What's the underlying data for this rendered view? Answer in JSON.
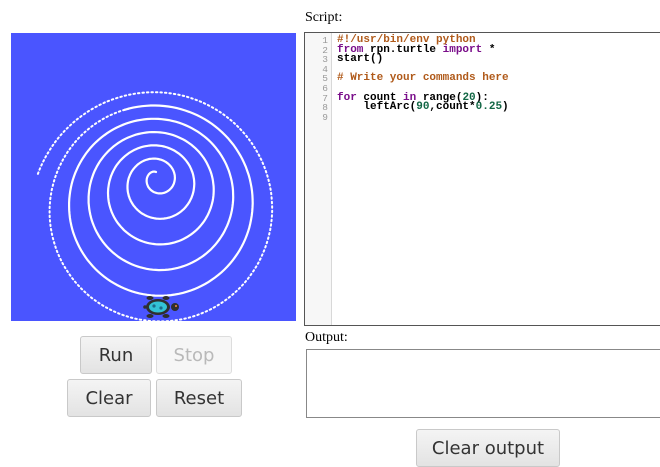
{
  "turtle_panel": {
    "background_color": "#4a55ff",
    "path_color": "#ffffff",
    "turtle_icon": "turtle-icon"
  },
  "controls": {
    "run_label": "Run",
    "stop_label": "Stop",
    "clear_label": "Clear",
    "reset_label": "Reset"
  },
  "script": {
    "label": "Script:",
    "line_numbers": [
      "1",
      "2",
      "3",
      "4",
      "5",
      "6",
      "7",
      "8",
      "9"
    ],
    "lines": [
      "#!/usr/bin/env python",
      "from rpn.turtle import *",
      "start()",
      "",
      "# Write your commands here",
      "",
      "for count in range(20):",
      "    leftArc(90,count*0.25)",
      ""
    ]
  },
  "output": {
    "label": "Output:",
    "text": "",
    "clear_label": "Clear output"
  }
}
